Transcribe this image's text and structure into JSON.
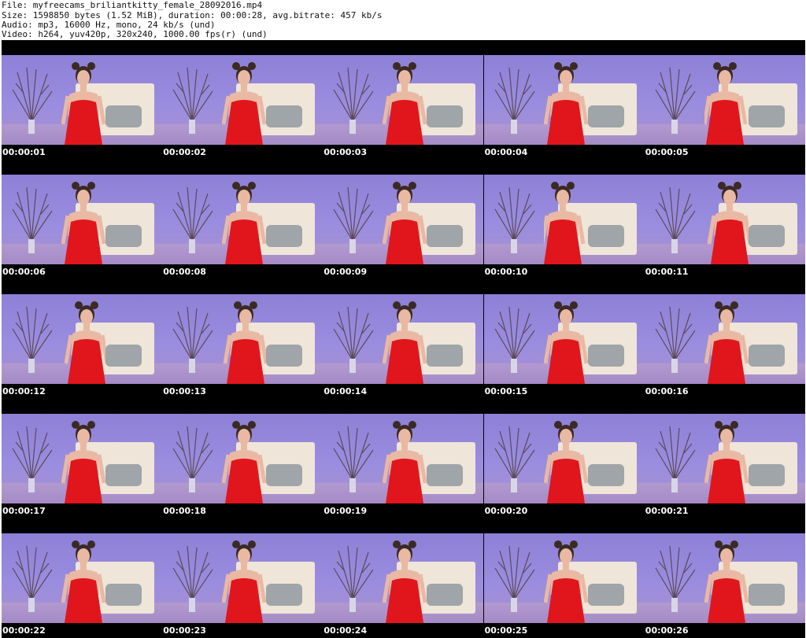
{
  "header": {
    "file": "File: myfreecams_briliantkitty_female_28092016.mp4",
    "size": "Size: 1598850 bytes (1.52 MiB), duration: 00:00:28, avg.bitrate: 457 kb/s",
    "audio": "Audio: mp3, 16000 Hz, mono, 24 kb/s (und)",
    "video": "Video: h264, yuv420p, 320x240, 1000.00 fps(r) (und)"
  },
  "timestamps": [
    "00:00:01",
    "00:00:02",
    "00:00:03",
    "00:00:04",
    "00:00:05",
    "00:00:06",
    "00:00:08",
    "00:00:09",
    "00:00:10",
    "00:00:11",
    "00:00:12",
    "00:00:13",
    "00:00:14",
    "00:00:15",
    "00:00:16",
    "00:00:17",
    "00:00:18",
    "00:00:19",
    "00:00:20",
    "00:00:21",
    "00:00:22",
    "00:00:23",
    "00:00:24",
    "00:00:25",
    "00:00:26"
  ],
  "colors": {
    "background_wall": "#9a8de0",
    "dress": "#e0161c",
    "timestamp_text": "#ffffff"
  }
}
